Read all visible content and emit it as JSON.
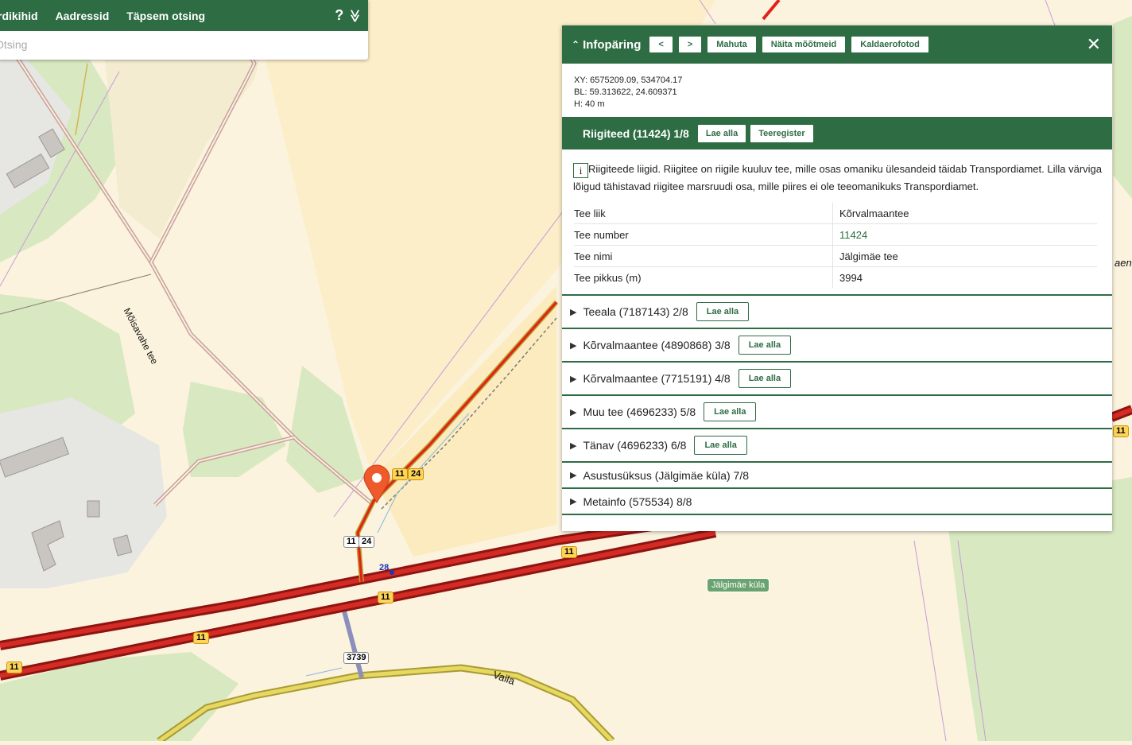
{
  "search": {
    "tabs": [
      "rdikihid",
      "Aadressid",
      "Täpsem otsing"
    ],
    "help_label": "?",
    "collapse_label": "≫",
    "placeholder": "Otsing",
    "value": ""
  },
  "info": {
    "title": "Infopäring",
    "prev_label": "<",
    "next_label": ">",
    "buttons": [
      "Mahuta",
      "Näita mõõtmeid",
      "Kaldaerofotod"
    ],
    "close_label": "✕",
    "coords": {
      "xy": "XY: 6575209.09, 534704.17",
      "bl": "BL: 59.313622, 24.609371",
      "h": "H: 40 m"
    },
    "section": {
      "title": "Riigiteed (11424) 1/8",
      "buttons": [
        "Lae alla",
        "Teeregister"
      ]
    },
    "description": "Riigiteede liigid. Riigitee on riigile kuuluv tee, mille osas omaniku ülesandeid täidab Transpordiamet. Lilla värviga lõigud tähistavad riigitee marsruudi osa, mille piires ei ole teeomanikuks Transpordiamet.",
    "info_icon": "i",
    "attributes": [
      {
        "key": "Tee liik",
        "value": "Kõrvalmaantee"
      },
      {
        "key": "Tee number",
        "value": "11424"
      },
      {
        "key": "Tee nimi",
        "value": "Jälgimäe tee"
      },
      {
        "key": "Tee pikkus (m)",
        "value": "3994"
      }
    ],
    "accordion": [
      {
        "title": "Teeala (7187143) 2/8",
        "button": "Lae alla"
      },
      {
        "title": "Kõrvalmaantee (4890868) 3/8",
        "button": "Lae alla"
      },
      {
        "title": "Kõrvalmaantee (7715191) 4/8",
        "button": "Lae alla"
      },
      {
        "title": "Muu tee (4696233) 5/8",
        "button": "Lae alla"
      },
      {
        "title": "Tänav (4696233) 6/8",
        "button": "Lae alla"
      },
      {
        "title": "Asustusüksus (Jälgimäe küla) 7/8",
        "button": ""
      },
      {
        "title": "Metainfo (575534) 8/8",
        "button": ""
      }
    ]
  },
  "map": {
    "road_labels": [
      "Mõisavahe tee",
      "Vaila",
      "aen"
    ],
    "place_label": "Jälgimäe küla",
    "shields": [
      "11",
      "24",
      "11",
      "24",
      "11",
      "11",
      "11",
      "11",
      "11",
      "3739",
      "28"
    ],
    "colors": {
      "background": "#fbf3dd",
      "forest": "#d8e8c0",
      "main_road": "#c7201b",
      "secondary_road": "#c9b640",
      "accent": "#2e6d43"
    }
  }
}
